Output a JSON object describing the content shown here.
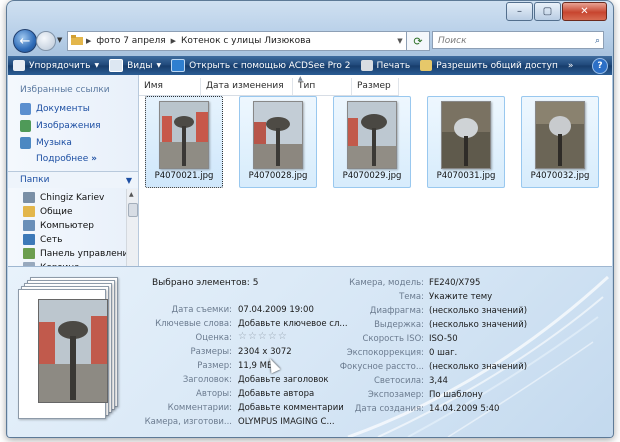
{
  "address": {
    "crumbs": [
      "фото 7 апреля",
      "Котенок с улицы Лизюкова"
    ]
  },
  "search": {
    "placeholder": "Поиск"
  },
  "toolbar": {
    "organize": "Упорядочить",
    "views": "Виды",
    "open_with": "Открыть с помощью ACDSee Pro 2",
    "print": "Печать",
    "share": "Разрешить общий доступ",
    "more": "»"
  },
  "nav": {
    "favorites_title": "Избранные ссылки",
    "favorites": [
      "Документы",
      "Изображения",
      "Музыка"
    ],
    "more": "Подробнее",
    "folders_title": "Папки",
    "tree": [
      "Chingiz Kariev",
      "Общие",
      "Компьютер",
      "Сеть",
      "Панель управления",
      "Корзина"
    ]
  },
  "columns": [
    "Имя",
    "Дата изменения",
    "Тип",
    "Размер"
  ],
  "files": [
    "P4070021.jpg",
    "P4070028.jpg",
    "P4070029.jpg",
    "P4070031.jpg",
    "P4070032.jpg"
  ],
  "details": {
    "selected": "Выбрано элементов: 5",
    "left": [
      {
        "label": "Дата съемки:",
        "value": "07.04.2009 19:00"
      },
      {
        "label": "Ключевые слова:",
        "value": "Добавьте ключевое сл..."
      },
      {
        "label": "Оценка:",
        "value": "☆☆☆☆☆"
      },
      {
        "label": "Размеры:",
        "value": "2304 x 3072"
      },
      {
        "label": "Размер:",
        "value": "11,9 МБ"
      },
      {
        "label": "Заголовок:",
        "value": "Добавьте заголовок"
      },
      {
        "label": "Авторы:",
        "value": "Добавьте автора"
      },
      {
        "label": "Комментарии:",
        "value": "Добавьте комментарии"
      },
      {
        "label": "Камера, изготови...",
        "value": "OLYMPUS IMAGING C..."
      }
    ],
    "right": [
      {
        "label": "Камера, модель:",
        "value": "FE240/X795"
      },
      {
        "label": "Тема:",
        "value": "Укажите тему"
      },
      {
        "label": "Диафрагма:",
        "value": "(несколько значений)"
      },
      {
        "label": "Выдержка:",
        "value": "(несколько значений)"
      },
      {
        "label": "Скорость ISO:",
        "value": "ISO-50"
      },
      {
        "label": "Экспокоррекция:",
        "value": "0 шаг."
      },
      {
        "label": "Фокусное рассто...",
        "value": "(несколько значений)"
      },
      {
        "label": "Светосила:",
        "value": "3,44"
      },
      {
        "label": "Экспозамер:",
        "value": "По шаблону"
      },
      {
        "label": "Дата создания:",
        "value": "14.04.2009 5:40"
      }
    ]
  }
}
